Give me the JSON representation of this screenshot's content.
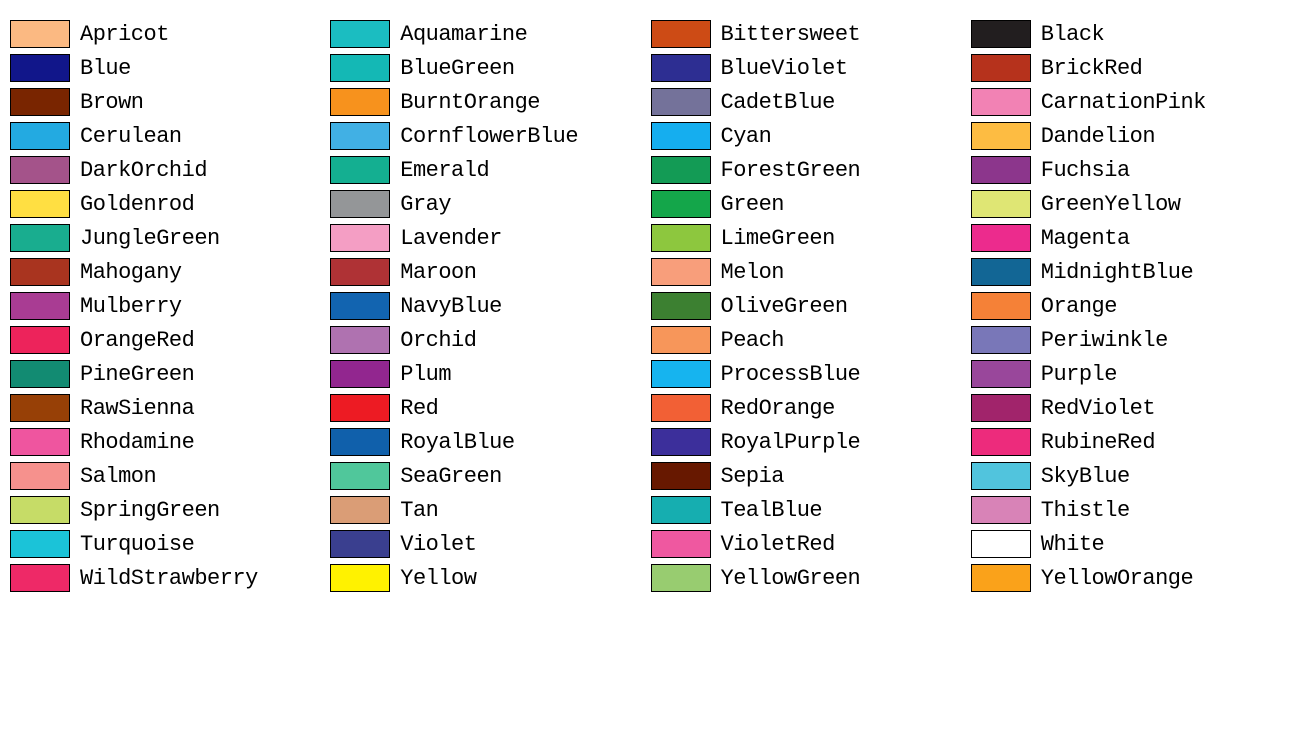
{
  "colors": [
    {
      "name": "Apricot",
      "hex": "#FBB982"
    },
    {
      "name": "Aquamarine",
      "hex": "#1BBDC1"
    },
    {
      "name": "Bittersweet",
      "hex": "#CD4B15"
    },
    {
      "name": "Black",
      "hex": "#221E1F"
    },
    {
      "name": "Blue",
      "hex": "#11168A"
    },
    {
      "name": "BlueGreen",
      "hex": "#14B8B5"
    },
    {
      "name": "BlueViolet",
      "hex": "#2D2E92"
    },
    {
      "name": "BrickRed",
      "hex": "#B6321C"
    },
    {
      "name": "Brown",
      "hex": "#792500"
    },
    {
      "name": "BurntOrange",
      "hex": "#F7921D"
    },
    {
      "name": "CadetBlue",
      "hex": "#74729A"
    },
    {
      "name": "CarnationPink",
      "hex": "#F282B4"
    },
    {
      "name": "Cerulean",
      "hex": "#23AAE1"
    },
    {
      "name": "CornflowerBlue",
      "hex": "#41B0E4"
    },
    {
      "name": "Cyan",
      "hex": "#15AEEF"
    },
    {
      "name": "Dandelion",
      "hex": "#FDBC42"
    },
    {
      "name": "DarkOrchid",
      "hex": "#A4538A"
    },
    {
      "name": "Emerald",
      "hex": "#14AF91"
    },
    {
      "name": "ForestGreen",
      "hex": "#139B55"
    },
    {
      "name": "Fuchsia",
      "hex": "#8C368C"
    },
    {
      "name": "Goldenrod",
      "hex": "#FFDF42"
    },
    {
      "name": "Gray",
      "hex": "#949698"
    },
    {
      "name": "Green",
      "hex": "#14A64A"
    },
    {
      "name": "GreenYellow",
      "hex": "#DFE674"
    },
    {
      "name": "JungleGreen",
      "hex": "#19AD8F"
    },
    {
      "name": "Lavender",
      "hex": "#F49EC4"
    },
    {
      "name": "LimeGreen",
      "hex": "#8DC73E"
    },
    {
      "name": "Magenta",
      "hex": "#EC2B8D"
    },
    {
      "name": "Mahogany",
      "hex": "#A9341F"
    },
    {
      "name": "Maroon",
      "hex": "#AF3235"
    },
    {
      "name": "Melon",
      "hex": "#F89E7B"
    },
    {
      "name": "MidnightBlue",
      "hex": "#126695"
    },
    {
      "name": "Mulberry",
      "hex": "#A93C93"
    },
    {
      "name": "NavyBlue",
      "hex": "#1264B0"
    },
    {
      "name": "OliveGreen",
      "hex": "#3C8031"
    },
    {
      "name": "Orange",
      "hex": "#F58137"
    },
    {
      "name": "OrangeRed",
      "hex": "#ED235B"
    },
    {
      "name": "Orchid",
      "hex": "#AF72B0"
    },
    {
      "name": "Peach",
      "hex": "#F7965A"
    },
    {
      "name": "Periwinkle",
      "hex": "#7977B8"
    },
    {
      "name": "PineGreen",
      "hex": "#128B72"
    },
    {
      "name": "Plum",
      "hex": "#92268F"
    },
    {
      "name": "ProcessBlue",
      "hex": "#16B4EF"
    },
    {
      "name": "Purple",
      "hex": "#99479B"
    },
    {
      "name": "RawSienna",
      "hex": "#974006"
    },
    {
      "name": "Red",
      "hex": "#ED1B23"
    },
    {
      "name": "RedOrange",
      "hex": "#F26035"
    },
    {
      "name": "RedViolet",
      "hex": "#A1246B"
    },
    {
      "name": "Rhodamine",
      "hex": "#EF559F"
    },
    {
      "name": "RoyalBlue",
      "hex": "#1060AB"
    },
    {
      "name": "RoyalPurple",
      "hex": "#3C2F9B"
    },
    {
      "name": "RubineRed",
      "hex": "#ED2B7C"
    },
    {
      "name": "Salmon",
      "hex": "#F6918D"
    },
    {
      "name": "SeaGreen",
      "hex": "#50C79B"
    },
    {
      "name": "Sepia",
      "hex": "#671800"
    },
    {
      "name": "SkyBlue",
      "hex": "#51C4DD"
    },
    {
      "name": "SpringGreen",
      "hex": "#C6DC67"
    },
    {
      "name": "Tan",
      "hex": "#DA9D76"
    },
    {
      "name": "TealBlue",
      "hex": "#16AEB0"
    },
    {
      "name": "Thistle",
      "hex": "#D883B7"
    },
    {
      "name": "Turquoise",
      "hex": "#1BC3D8"
    },
    {
      "name": "Violet",
      "hex": "#3A3F8F"
    },
    {
      "name": "VioletRed",
      "hex": "#EF58A0"
    },
    {
      "name": "White",
      "hex": "#FFFFFF"
    },
    {
      "name": "WildStrawberry",
      "hex": "#EE2967"
    },
    {
      "name": "Yellow",
      "hex": "#FFF200"
    },
    {
      "name": "YellowGreen",
      "hex": "#98CC70"
    },
    {
      "name": "YellowOrange",
      "hex": "#FAA21A"
    }
  ]
}
